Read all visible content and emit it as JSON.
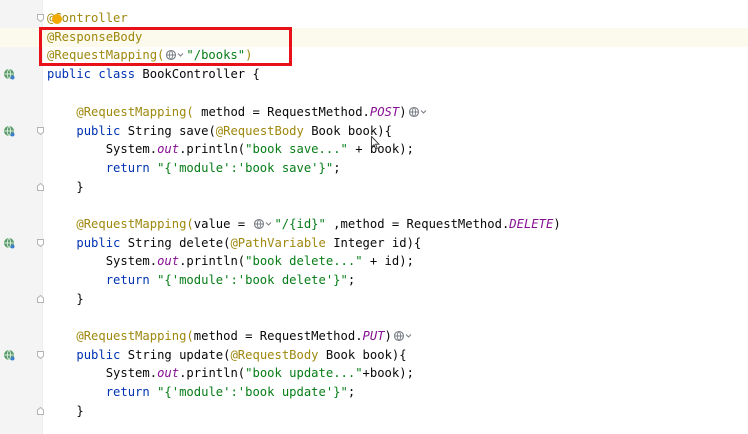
{
  "colors": {
    "annotation": "#9e880d",
    "string": "#067d17",
    "keyword": "#0033b3",
    "static_field": "#871094",
    "highlight_box": "#e8111a",
    "current_line": "#fcfaed",
    "gutter": "#f4f4f4"
  },
  "code": {
    "l1": {
      "a": "@Controller"
    },
    "l2": {
      "a": "@ResponseBody"
    },
    "l3": {
      "a": "@RequestMapping(",
      "s": "\"/books\"",
      "p": ")"
    },
    "l4": {
      "kw": "public class ",
      "p": "BookController {"
    },
    "l6": {
      "a": "@RequestMapping(",
      "p1": " method = RequestMethod.",
      "f": "POST",
      "p2": ")"
    },
    "l7": {
      "kw": "public ",
      "p1": "String save(",
      "a": "@RequestBody",
      "p2": " Book book){"
    },
    "l8": {
      "p1": "System.",
      "f": "out",
      "p2": ".println(",
      "s": "\"book save...\"",
      "p3": " + book);"
    },
    "l9": {
      "kw": "return ",
      "s": "\"{'module':'book save'}\"",
      "p": ";"
    },
    "l10": {
      "p": "}"
    },
    "l12": {
      "a": "@RequestMapping(",
      "p1": "value = ",
      "s": "\"/{id}\"",
      "p2": " ,method = RequestMethod.",
      "f": "DELETE",
      "p3": ")"
    },
    "l13": {
      "kw": "public ",
      "p1": "String delete(",
      "a": "@PathVariable",
      "p2": " Integer id){"
    },
    "l14": {
      "p1": "System.",
      "f": "out",
      "p2": ".println(",
      "s": "\"book delete...\"",
      "p3": " + id);"
    },
    "l15": {
      "kw": "return ",
      "s": "\"{'module':'book delete'}\"",
      "p": ";"
    },
    "l16": {
      "p": "}"
    },
    "l18": {
      "a": "@RequestMapping(",
      "p1": "method = RequestMethod.",
      "f": "PUT",
      "p2": ")"
    },
    "l19": {
      "kw": "public ",
      "p1": "String update(",
      "a": "@RequestBody",
      "p2": " Book book){"
    },
    "l20": {
      "p1": "System.",
      "f": "out",
      "p2": ".println(",
      "s": "\"book update...\"",
      "p3": "+book);"
    },
    "l21": {
      "kw": "return ",
      "s": "\"{'module':'book update'}\"",
      "p": ";"
    },
    "l22": {
      "p": "}"
    }
  },
  "icons": {
    "gutter_marker": "web-endpoint-icon",
    "inlay_hint": "globe-dropdown-icon",
    "fold": "fold-marker-icon",
    "intention": "lightbulb-icon",
    "pointer": "mouse-cursor-icon"
  }
}
